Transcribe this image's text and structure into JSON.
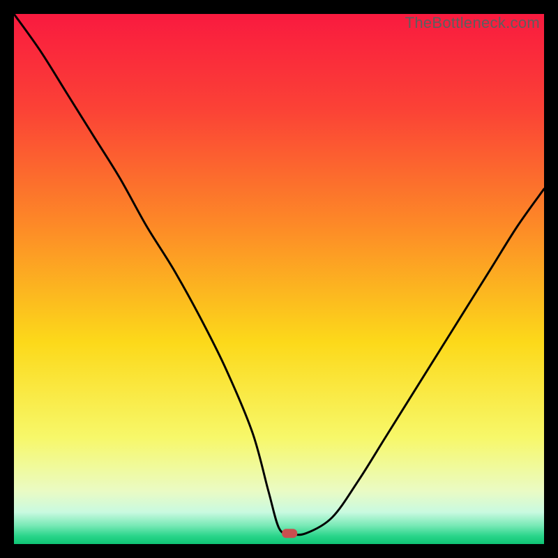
{
  "watermark": "TheBottleneck.com",
  "chart_data": {
    "type": "line",
    "title": "",
    "xlabel": "",
    "ylabel": "",
    "xlim": [
      0,
      100
    ],
    "ylim": [
      0,
      100
    ],
    "x": [
      0,
      5,
      10,
      15,
      20,
      25,
      30,
      35,
      40,
      45,
      48,
      50,
      52,
      55,
      60,
      65,
      70,
      75,
      80,
      85,
      90,
      95,
      100
    ],
    "values": [
      100,
      93,
      85,
      77,
      69,
      60,
      52,
      43,
      33,
      21,
      10,
      3,
      2,
      2,
      5,
      12,
      20,
      28,
      36,
      44,
      52,
      60,
      67
    ],
    "marker": {
      "x": 52,
      "y": 2,
      "color": "#c94f4f"
    },
    "gradient_stops": [
      {
        "offset": 0.0,
        "color": "#f91a3f"
      },
      {
        "offset": 0.18,
        "color": "#fb4236"
      },
      {
        "offset": 0.4,
        "color": "#fd8a27"
      },
      {
        "offset": 0.62,
        "color": "#fcd91a"
      },
      {
        "offset": 0.8,
        "color": "#f7f86a"
      },
      {
        "offset": 0.9,
        "color": "#eafbc4"
      },
      {
        "offset": 0.94,
        "color": "#c9fae0"
      },
      {
        "offset": 0.965,
        "color": "#78e9b6"
      },
      {
        "offset": 0.985,
        "color": "#29d58a"
      },
      {
        "offset": 1.0,
        "color": "#0fc574"
      }
    ],
    "curve_color": "#000000",
    "curve_width": 3
  },
  "layout": {
    "plot_size": 760,
    "frame_inset": 20
  }
}
